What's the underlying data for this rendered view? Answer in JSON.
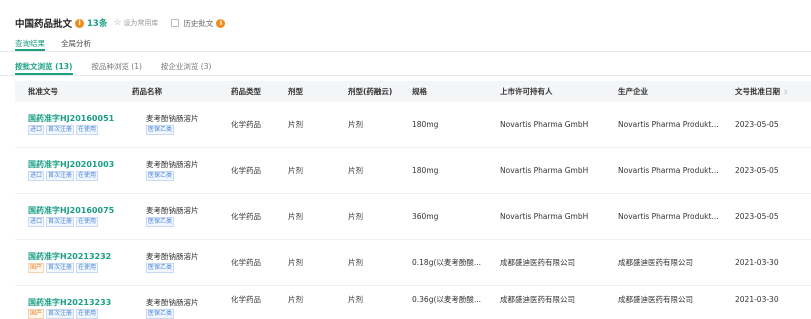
{
  "header": {
    "title": "中国药品批文",
    "count": "13条",
    "favorite_label": "设为常用库",
    "history_label": "历史批文",
    "icon_info": "info-icon",
    "icon_star": "star-icon"
  },
  "tabs": [
    {
      "label": "查询结果",
      "active": true
    },
    {
      "label": "全局分析",
      "active": false
    }
  ],
  "subtabs": [
    {
      "label": "按批文浏览 (13)",
      "active": true
    },
    {
      "label": "按品种浏览 (1)",
      "active": false
    },
    {
      "label": "按企业浏览 (3)",
      "active": false
    }
  ],
  "columns": [
    "批准文号",
    "药品名称",
    "药品类型",
    "剂型",
    "剂型(药融云)",
    "规格",
    "上市许可持有人",
    "生产企业",
    "文号批准日期"
  ],
  "rows": [
    {
      "approval_no": "国药准字HJ20160051",
      "tags": [
        "进口",
        "首次注册",
        "在使用"
      ],
      "drug_name": "麦考酚钠肠溶片",
      "insurance": "医保乙类",
      "drug_type": "化学药品",
      "dosage_form": "片剂",
      "dosage_form_yry": "片剂",
      "spec": "180mg",
      "holder": "Novartis Pharma GmbH",
      "manufacturer": "Novartis Pharma Produkt...",
      "date": "2023-05-05"
    },
    {
      "approval_no": "国药准字HJ20201003",
      "tags": [
        "进口",
        "首次注册",
        "在使用"
      ],
      "drug_name": "麦考酚钠肠溶片",
      "insurance": "医保乙类",
      "drug_type": "化学药品",
      "dosage_form": "片剂",
      "dosage_form_yry": "片剂",
      "spec": "180mg",
      "holder": "Novartis Pharma GmbH",
      "manufacturer": "Novartis Pharma Produkt...",
      "date": "2023-05-05"
    },
    {
      "approval_no": "国药准字HJ20160075",
      "tags": [
        "进口",
        "首次注册",
        "在使用"
      ],
      "drug_name": "麦考酚钠肠溶片",
      "insurance": "医保乙类",
      "drug_type": "化学药品",
      "dosage_form": "片剂",
      "dosage_form_yry": "片剂",
      "spec": "360mg",
      "holder": "Novartis Pharma GmbH",
      "manufacturer": "Novartis Pharma Produkt...",
      "date": "2023-05-05"
    },
    {
      "approval_no": "国药准字H20213232",
      "tags": [
        "国产",
        "首次注册",
        "在使用"
      ],
      "drug_name": "麦考酚钠肠溶片",
      "insurance": "医保乙类",
      "drug_type": "化学药品",
      "dosage_form": "片剂",
      "dosage_form_yry": "片剂",
      "spec": "0.18g(以麦考酚酸...",
      "holder": "成都盛迪医药有限公司",
      "manufacturer": "成都盛迪医药有限公司",
      "date": "2021-03-30"
    },
    {
      "approval_no": "国药准字H20213233",
      "tags": [
        "国产",
        "首次注册",
        "在使用"
      ],
      "drug_name": "麦考酚钠肠溶片",
      "insurance": "医保乙类",
      "drug_type": "化学药品",
      "dosage_form": "片剂",
      "dosage_form_yry": "片剂",
      "spec": "0.36g(以麦考酚酸...",
      "holder": "成都盛迪医药有限公司",
      "manufacturer": "成都盛迪医药有限公司",
      "date": "2021-03-30"
    }
  ],
  "colors": {
    "accent": "#1a9e84",
    "info_orange": "#f08c1a",
    "tag_blue": "#4b86d6",
    "tag_orange": "#e8822a"
  }
}
